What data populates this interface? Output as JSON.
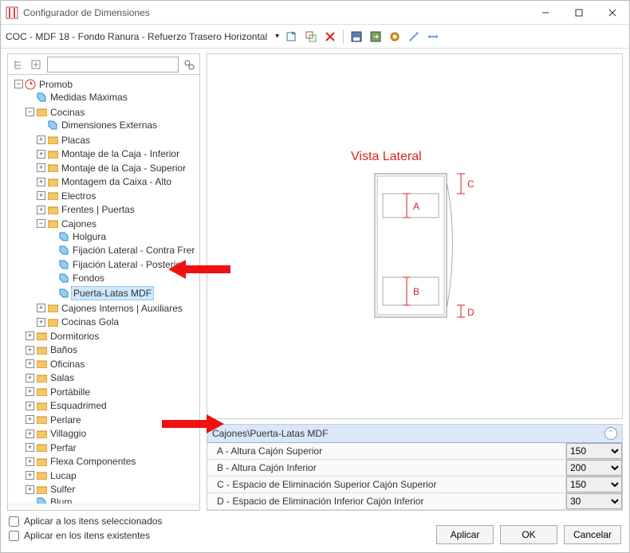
{
  "window": {
    "title": "Configurador de Dimensiones",
    "context_path": "COC - MDF 18 - Fondo Ranura - Refuerzo Trasero Horizontal"
  },
  "search": {
    "placeholder": ""
  },
  "tree": {
    "root": "Promob",
    "items": {
      "medidas": "Medidas Máximas",
      "cocinas": "Cocinas",
      "dim_ext": "Dimensiones Externas",
      "placas": "Placas",
      "montaje_inf": "Montaje de la Caja - Inferior",
      "montaje_sup": "Montaje de la Caja - Superior",
      "montagem_alto": "Montagem da Caixa - Alto",
      "electros": "Electros",
      "frentes": "Frentes | Puertas",
      "cajones": "Cajones",
      "holgura": "Holgura",
      "fij_contra": "Fijación Lateral - Contra Frer",
      "fij_post": "Fijación Lateral - Posterior",
      "fondos": "Fondos",
      "puerta_latas": "Puerta-Latas MDF",
      "cajones_int": "Cajones Internos | Auxiliares",
      "cocinas_gola": "Cocinas Gola",
      "dormitorios": "Dormitorios",
      "banos": "Baños",
      "oficinas": "Oficinas",
      "salas": "Salas",
      "portabille": "Portábille",
      "esquadrimed": "Esquadrimed",
      "perlare": "Perlare",
      "villaggio": "Villaggio",
      "perfar": "Perfar",
      "flexa": "Flexa Componentes",
      "lucap": "Lucap",
      "sulfer": "Sulfer",
      "blum": "Blum"
    }
  },
  "preview": {
    "title": "Vista Lateral",
    "labels": {
      "a": "A",
      "b": "B",
      "c": "C",
      "d": "D"
    }
  },
  "props": {
    "breadcrumb": "Cajones\\Puerta-Latas MDF",
    "rows": [
      {
        "label": "A - Altura Cajón Superior",
        "value": "150"
      },
      {
        "label": "B - Altura Cajón Inferior",
        "value": "200"
      },
      {
        "label": "C - Espacio de Eliminación Superior Cajón Superior",
        "value": "150"
      },
      {
        "label": "D - Espacio de Eliminación Inferior Cajón Inferior",
        "value": "30"
      }
    ]
  },
  "checks": {
    "apply_selected": "Aplicar a los itens seleccionados",
    "apply_existing": "Aplicar en los itens existentes"
  },
  "buttons": {
    "apply": "Aplicar",
    "ok": "OK",
    "cancel": "Cancelar"
  }
}
